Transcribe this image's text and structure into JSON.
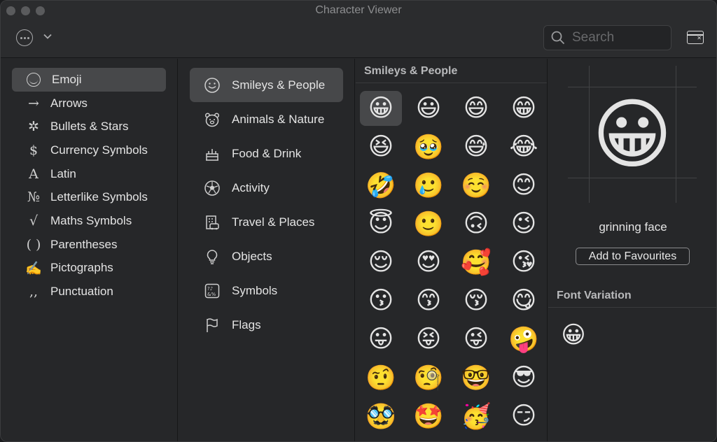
{
  "window": {
    "title": "Character Viewer"
  },
  "toolbar": {
    "search_placeholder": "Search"
  },
  "categories": [
    {
      "label": "Emoji",
      "icon": "☺",
      "selected": true
    },
    {
      "label": "Arrows",
      "icon": "→"
    },
    {
      "label": "Bullets & Stars",
      "icon": "✲"
    },
    {
      "label": "Currency Symbols",
      "icon": "$"
    },
    {
      "label": "Latin",
      "icon": "A"
    },
    {
      "label": "Letterlike Symbols",
      "icon": "№"
    },
    {
      "label": "Maths Symbols",
      "icon": "√"
    },
    {
      "label": "Parentheses",
      "icon": "( )"
    },
    {
      "label": "Pictographs",
      "icon": "✍"
    },
    {
      "label": "Punctuation",
      "icon": ",,"
    }
  ],
  "subcategories": [
    {
      "label": "Smileys & People",
      "icon": "smiley-icon",
      "selected": true
    },
    {
      "label": "Animals & Nature",
      "icon": "bear-icon"
    },
    {
      "label": "Food & Drink",
      "icon": "cake-icon"
    },
    {
      "label": "Activity",
      "icon": "ball-icon"
    },
    {
      "label": "Travel & Places",
      "icon": "building-icon"
    },
    {
      "label": "Objects",
      "icon": "bulb-icon"
    },
    {
      "label": "Symbols",
      "icon": "symbols-icon"
    },
    {
      "label": "Flags",
      "icon": "flag-icon"
    }
  ],
  "grid": {
    "header": "Smileys & People",
    "emojis": [
      "😀",
      "😃",
      "😄",
      "😁",
      "😆",
      "🥹",
      "😅",
      "😂",
      "🤣",
      "🥲",
      "☺️",
      "😊",
      "😇",
      "🙂",
      "🙃",
      "😉",
      "😌",
      "😍",
      "🥰",
      "😘",
      "😗",
      "😙",
      "😚",
      "😋",
      "😛",
      "😝",
      "😜",
      "🤪",
      "🤨",
      "🧐",
      "🤓",
      "😎",
      "🥸",
      "🤩",
      "🥳",
      "😏"
    ],
    "selected_index": 0
  },
  "detail": {
    "glyph": "😀",
    "name": "grinning face",
    "favourite_label": "Add to Favourites",
    "font_variation_header": "Font Variation",
    "variants": [
      "😀"
    ]
  }
}
